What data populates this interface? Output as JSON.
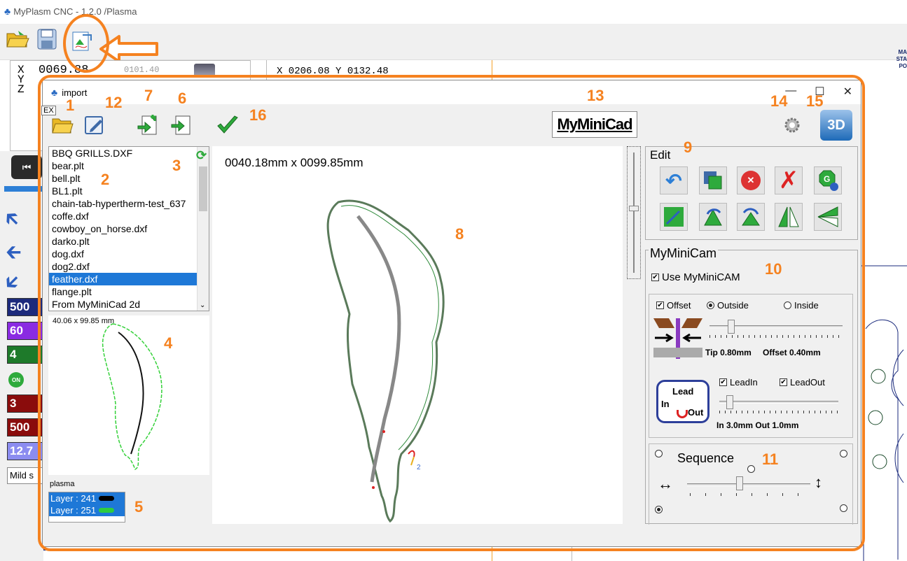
{
  "app": {
    "title": "MyPlasm CNC - 1.2.0  /Plasma",
    "ribbon_right": [
      "MA",
      "STA",
      "PO"
    ],
    "coords": {
      "x_label": "X",
      "y_label": "Y",
      "z_label": "Z",
      "x_value": "0069.88",
      "x_small": "0101.40"
    },
    "readout": "X 0206.08  Y 0132.48",
    "stats": [
      "500",
      "60",
      "4",
      "3",
      "500",
      "12.7"
    ],
    "on_label": "ON",
    "material": "Mild s"
  },
  "dialog": {
    "title": "import",
    "ex_label": "EX",
    "minicad_label": "MyMiniCad",
    "three_d_label": "3D",
    "files": [
      "BBQ GRILLS.DXF",
      "bear.plt",
      "bell.plt",
      "BL1.plt",
      "chain-tab-hypertherm-test_637",
      "coffe.dxf",
      "cowboy_on_horse.dxf",
      "darko.plt",
      "dog.dxf",
      "dog2.dxf",
      "feather.dxf",
      "flange.plt",
      "From MyMiniCad 2d"
    ],
    "selected_file": "feather.dxf",
    "preview_dims": "40.06 x 99.85 mm",
    "canvas_dims": "0040.18mm x  0099.85mm",
    "layers_label": "plasma",
    "layers": [
      {
        "label": "Layer : 241",
        "color": "#000000"
      },
      {
        "label": "Layer : 251",
        "color": "#2ecc40"
      }
    ],
    "edit_label": "Edit",
    "cam_label": "MyMiniCam",
    "use_cam_label": "Use MyMiniCAM",
    "offset_label": "Offset",
    "outside_label": "Outside",
    "inside_label": "Inside",
    "tip_label": "Tip 0.80mm",
    "offset_value_label": "Offset 0.40mm",
    "lead_in_label": "LeadIn",
    "lead_out_label": "LeadOut",
    "lead_icon": {
      "lead": "Lead",
      "in": "In",
      "out": "Out"
    },
    "lead_values": "In 3.0mm Out 1.0mm",
    "sequence_label": "Sequence",
    "canvas_marker": "2"
  },
  "callouts": [
    "1",
    "12",
    "7",
    "6",
    "16",
    "13",
    "14",
    "15",
    "2",
    "3",
    "9",
    "8",
    "10",
    "4",
    "5",
    "11"
  ],
  "colors": {
    "accent": "#f58220",
    "selection": "#1e78d7"
  }
}
